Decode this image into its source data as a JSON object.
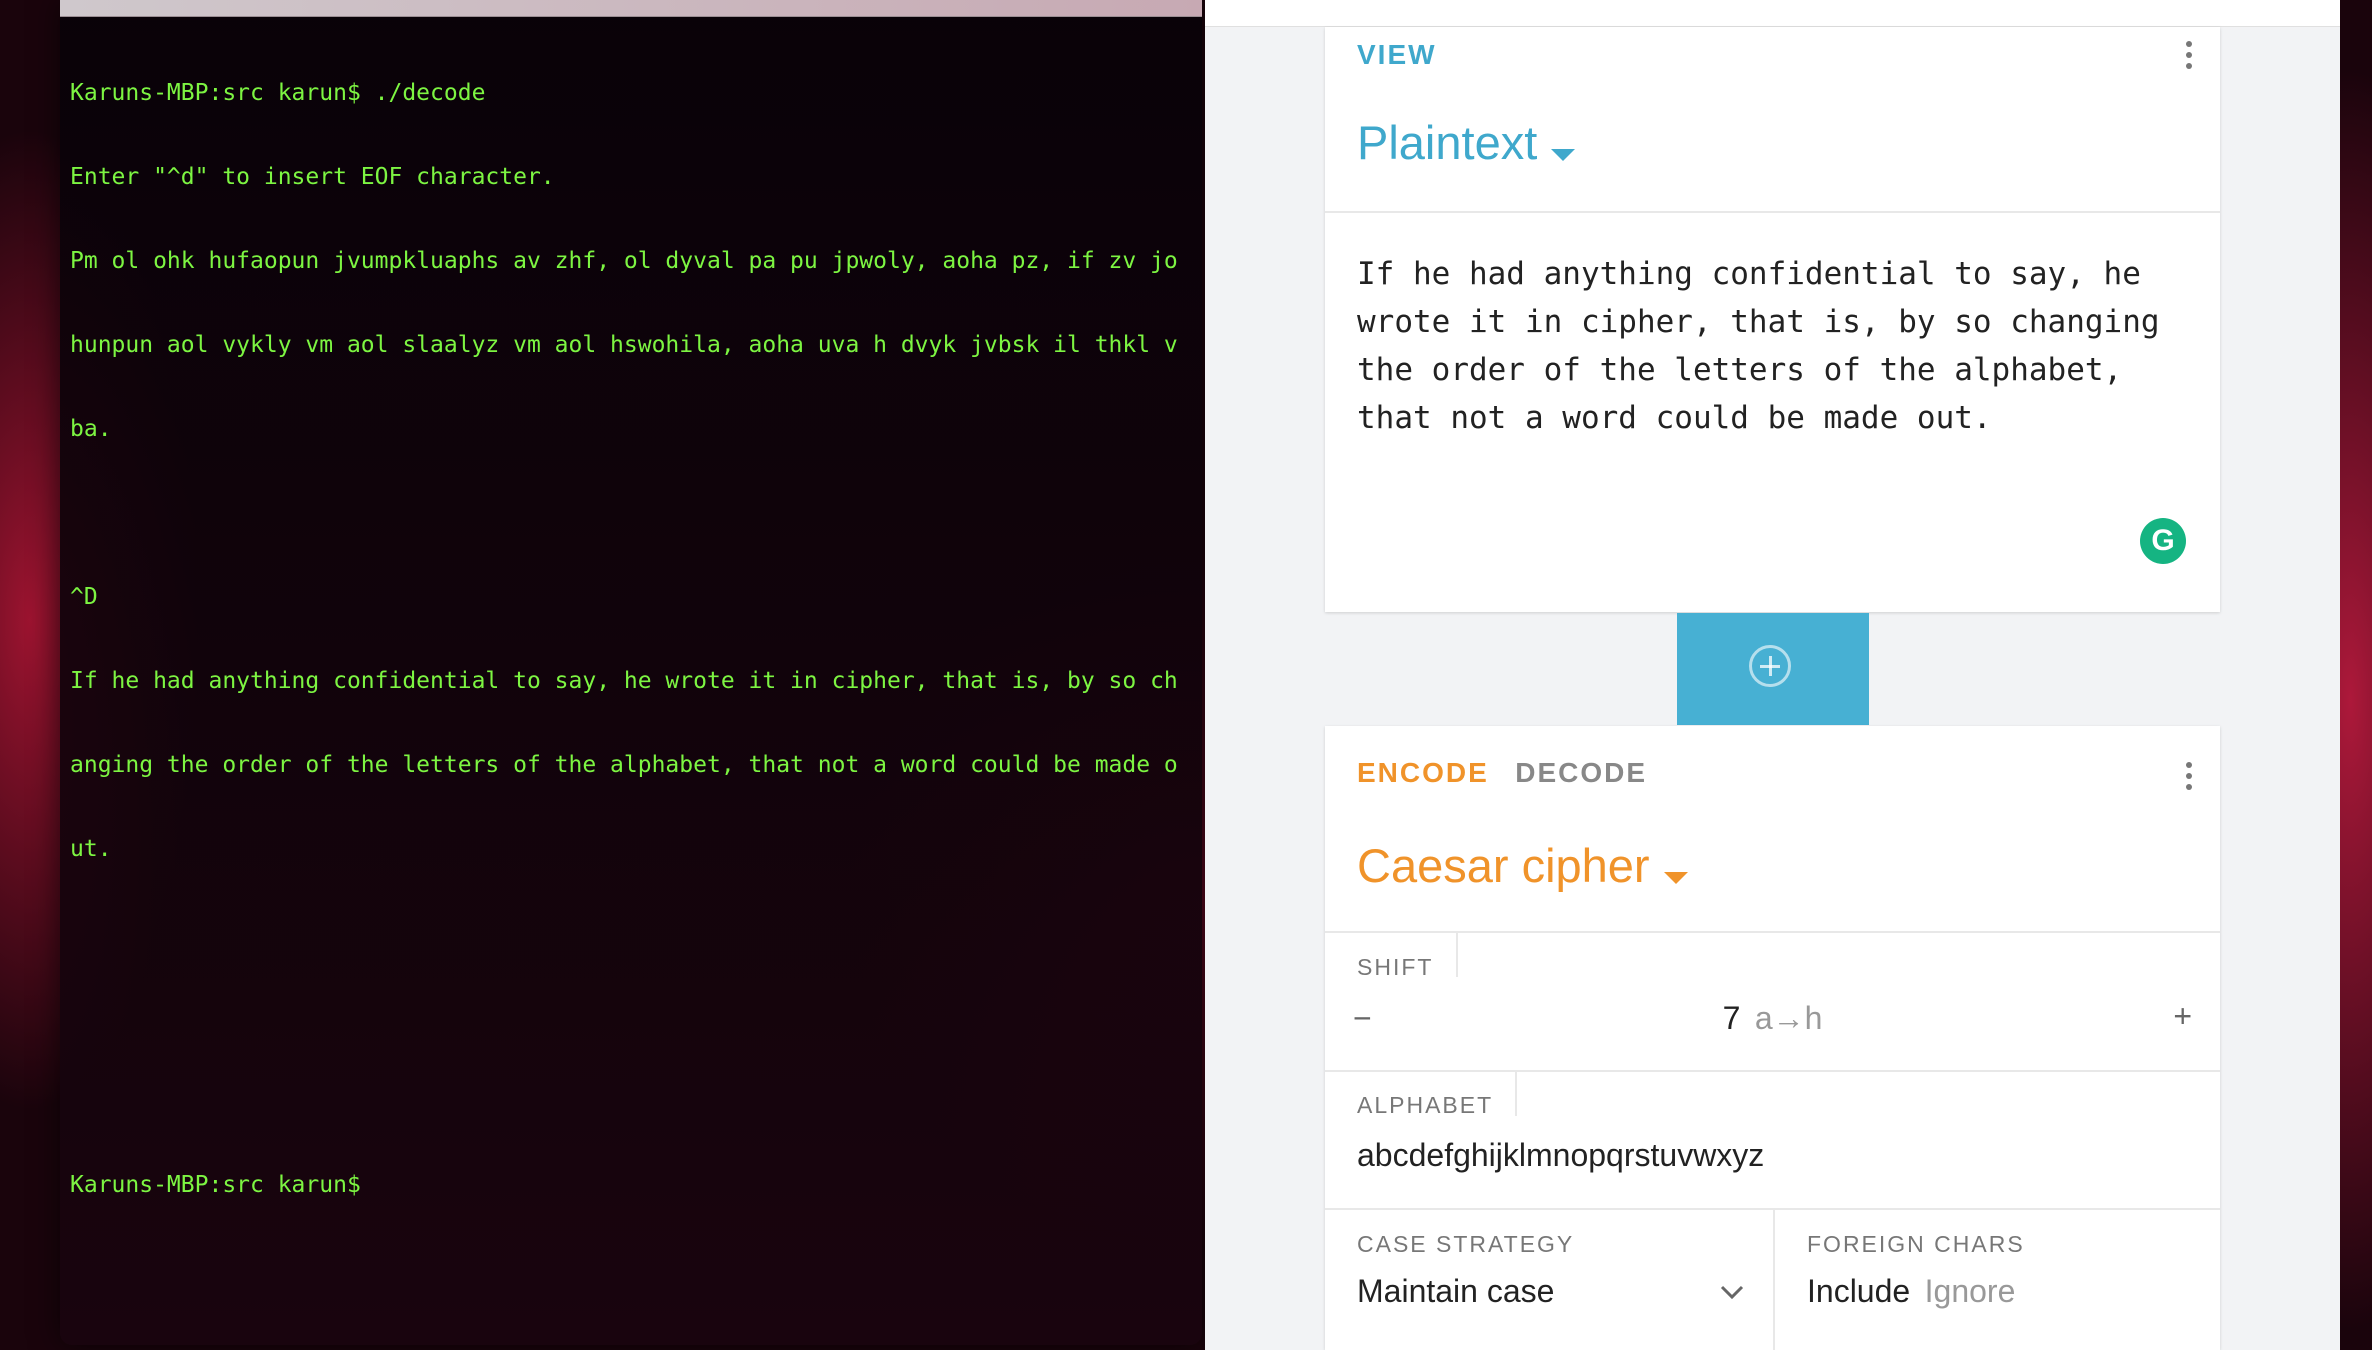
{
  "terminal": {
    "lines": [
      "Karuns-MBP:src karun$ ./decode",
      "Enter \"^d\" to insert EOF character.",
      "Pm ol ohk hufaopun jvumpkluaphs av zhf, ol dyval pa pu jpwoly, aoha pz, if zv jo",
      "hunpun aol vykly vm aol slaalyz vm aol hswohila, aoha uva h dvyk jvbsk il thkl v",
      "ba.",
      "",
      "^D",
      "If he had anything confidential to say, he wrote it in cipher, that is, by so ch",
      "anging the order of the letters of the alphabet, that not a word could be made o",
      "ut.",
      "",
      "",
      "",
      "Karuns-MBP:src karun$"
    ]
  },
  "view_card": {
    "label": "VIEW",
    "format": "Plaintext",
    "text": "If he had anything confidential to say, he\nwrote it in cipher, that is, by so changing\nthe order of the letters of the alphabet,\nthat not a word could be made out.",
    "grammarly_badge": "G"
  },
  "add_button": {
    "icon": "plus-circle-icon"
  },
  "cipher_card": {
    "tabs": {
      "encode": "ENCODE",
      "decode": "DECODE"
    },
    "cipher": "Caesar cipher",
    "shift": {
      "label": "SHIFT",
      "minus": "−",
      "value": "7",
      "mapping": "a→h",
      "plus": "+"
    },
    "alphabet": {
      "label": "ALPHABET",
      "value": "abcdefghijklmnopqrstuvwxyz"
    },
    "case_strategy": {
      "label": "CASE STRATEGY",
      "value": "Maintain case"
    },
    "foreign_chars": {
      "label": "FOREIGN CHARS",
      "include": "Include",
      "ignore": "Ignore"
    }
  },
  "colors": {
    "terminal_text": "#7df542",
    "view_accent": "#3fa8cc",
    "encode_accent": "#f0932a",
    "add_button_bg": "#47b0d3",
    "grammarly": "#15b482"
  }
}
